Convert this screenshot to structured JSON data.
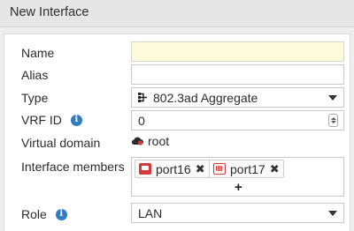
{
  "dialog": {
    "title": "New Interface"
  },
  "fields": {
    "name": {
      "label": "Name",
      "value": ""
    },
    "alias": {
      "label": "Alias",
      "value": ""
    },
    "type": {
      "label": "Type",
      "value": "802.3ad Aggregate",
      "icon": "aggregate-icon"
    },
    "vrf_id": {
      "label": "VRF ID",
      "value": "0"
    },
    "virtual_domain": {
      "label": "Virtual domain",
      "value": "root",
      "icon": "vdom-cloud-icon"
    },
    "interface_members": {
      "label": "Interface members",
      "members": [
        {
          "name": "port16",
          "icon": "port-icon"
        },
        {
          "name": "port17",
          "icon": "port-icon"
        }
      ],
      "add_label": "+"
    },
    "role": {
      "label": "Role",
      "value": "LAN"
    }
  },
  "colors": {
    "highlight_field": "#fefbdc",
    "info_icon": "#2f7cc4",
    "port_icon": "#d23b3b"
  }
}
